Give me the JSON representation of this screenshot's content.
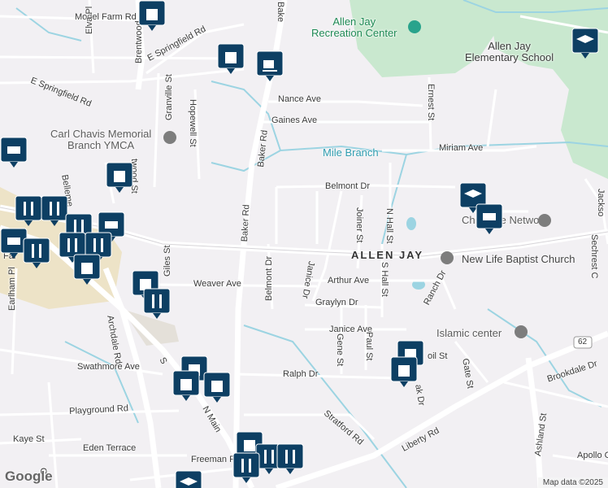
{
  "colors": {
    "land": "#f2f0f3",
    "park": "#c9e8cf",
    "water": "#9cd4e2",
    "road": "#ffffff",
    "major_road": "#ffffff",
    "pin": "#0d3f63",
    "poi_gray": "#7d7d7d",
    "poi_teal": "#29a38c"
  },
  "streets": {
    "model_farm": "Model Farm Rd",
    "elva": "Elva Pl",
    "e_springfield_top": "E Springfield Rd",
    "e_springfield_left": "E Springfield Rd",
    "brentwood": "Brentwood",
    "baker_top": "Bake",
    "baker_mid": "Baker Rd",
    "baker_lower": "Baker Rd",
    "granville": "Granville St",
    "hopewell": "Hopewell St",
    "nance": "Nance Ave",
    "gaines": "Gaines Ave",
    "miriam": "Miriam Ave",
    "belmont_dr_top": "Belmont Dr",
    "belmont_dr_vert": "Belmont Dr",
    "ernest": "Ernest St",
    "joiner": "Joiner St",
    "n_hall": "N Hall St",
    "s_hall": "S Hall St",
    "janice_dr": "Janice Dr",
    "arthur": "Arthur Ave",
    "graylyn": "Graylyn Dr",
    "janice_ave": "Janice Ave",
    "gene": "Gene St",
    "paul": "Paul St",
    "ranch": "Ranch Dr",
    "weaver": "Weaver Ave",
    "giles": "Giles St",
    "archdale": "Archdale Rd",
    "swathmore": "Swathmore Ave",
    "ralph": "Ralph Dr",
    "playground": "Playground Rd",
    "kaye": "Kaye St",
    "eden": "Eden Terrace",
    "stafford": "Stratford Rd",
    "liberty": "Liberty Rd",
    "freeman": "Freeman R",
    "n_main": "N Main",
    "s_main": "S",
    "earlham": "Earlham Pl",
    "belleme": "Belleme",
    "gate": "Gate St",
    "brookdale": "Brookdale Dr",
    "ashland": "Ashland St",
    "apollo": "Apollo C",
    "jackson": "Jackso",
    "sechrest": "Sechrest C",
    "oil": "oil St",
    "ak": "ak Dr",
    "wood_st": "twood St",
    "route62": "62",
    "fai": "Fai",
    "gr": "G"
  },
  "places": {
    "rec_center": "Allen Jay\nRecreation Center",
    "elementary": "Allen Jay\nElementary School",
    "ymca": "Carl Chavis Memorial\nBranch YMCA",
    "mile_branch": "Mile Branch",
    "area": "ALLEN JAY",
    "church": "New Life Baptist Church",
    "childcare": "Childcare Network",
    "islamic": "Islamic center"
  },
  "footer": {
    "logo": "Google",
    "copyright": "Map data ©2025"
  }
}
